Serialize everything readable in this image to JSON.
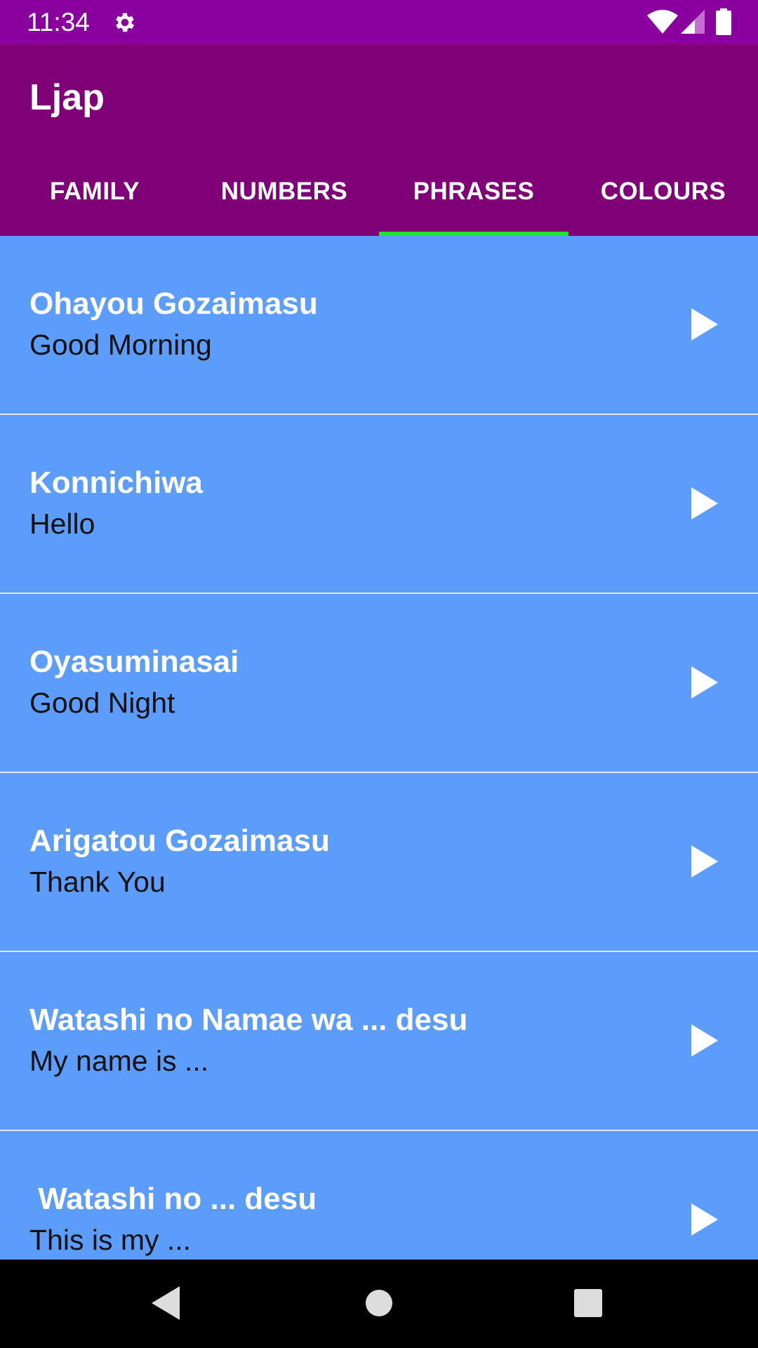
{
  "status_bar": {
    "time": "11:34",
    "icons": [
      "gear-icon",
      "wifi-icon",
      "signal-icon",
      "battery-icon"
    ]
  },
  "app_bar": {
    "title": "Ljap"
  },
  "tabs": [
    {
      "label": "FAMILY",
      "selected": false
    },
    {
      "label": "NUMBERS",
      "selected": false
    },
    {
      "label": "PHRASES",
      "selected": true
    },
    {
      "label": "COLOURS",
      "selected": false
    }
  ],
  "phrases": [
    {
      "japanese": "Ohayou Gozaimasu",
      "english": "Good Morning"
    },
    {
      "japanese": "Konnichiwa",
      "english": "Hello"
    },
    {
      "japanese": "Oyasuminasai",
      "english": "Good Night"
    },
    {
      "japanese": "Arigatou Gozaimasu",
      "english": "Thank You"
    },
    {
      "japanese": "Watashi no Namae wa ... desu",
      "english": "My name is ..."
    },
    {
      "japanese": " Watashi no ... desu",
      "english": "This is my ..."
    }
  ],
  "colors": {
    "status_bar": "#8a009f",
    "app_bar": "#800078",
    "tab_indicator": "#22e23a",
    "list_background": "#5c9cfa",
    "nav_bar": "#000000"
  },
  "nav_bar": {
    "icons": [
      "back-icon",
      "home-icon",
      "recents-icon"
    ]
  }
}
